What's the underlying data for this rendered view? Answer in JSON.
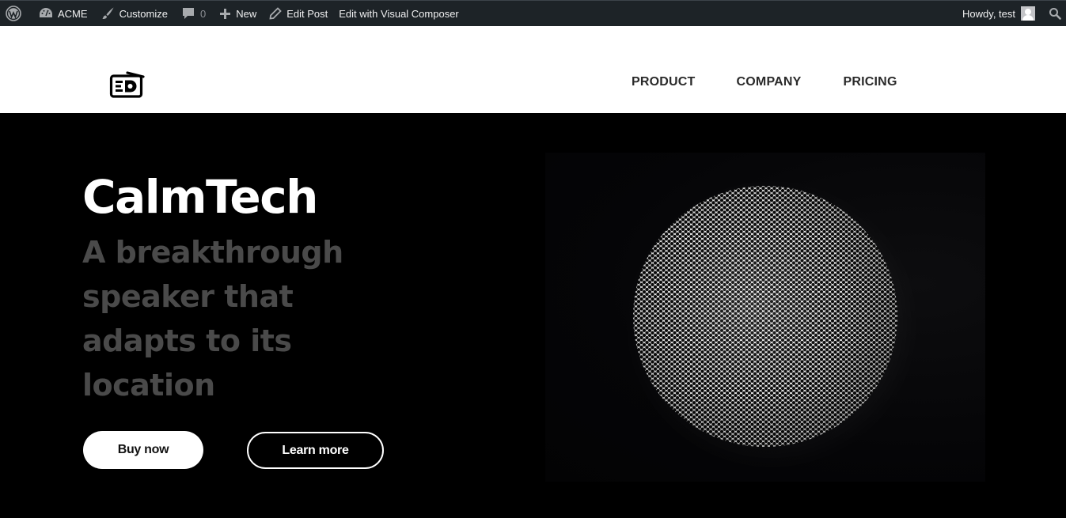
{
  "admin_bar": {
    "wp_logo_icon": "wordpress-icon",
    "site_name": "ACME",
    "site_icon": "dashboard-icon",
    "customize": "Customize",
    "customize_icon": "brush-icon",
    "comments_count": "0",
    "comments_icon": "comment-icon",
    "new": "New",
    "new_icon": "plus-icon",
    "edit_post": "Edit Post",
    "edit_post_icon": "pencil-icon",
    "edit_visual_composer": "Edit with Visual Composer",
    "howdy": "Howdy, test",
    "avatar_icon": "user-avatar-icon",
    "search_icon": "search-icon"
  },
  "header": {
    "logo_icon": "radio-logo-icon",
    "nav": [
      {
        "label": "PRODUCT"
      },
      {
        "label": "COMPANY"
      },
      {
        "label": "PRICING"
      }
    ]
  },
  "hero": {
    "title": "CalmTech",
    "subtitle": "A breakthrough speaker that adapts to its location",
    "buttons": {
      "buy": "Buy now",
      "learn": "Learn more"
    },
    "image": "speaker-grille-photo"
  },
  "colors": {
    "admin_bar_bg": "#1d2327",
    "hero_bg": "#000000",
    "subtitle_color": "#4a4a4a",
    "nav_text": "#2a2a2a"
  }
}
